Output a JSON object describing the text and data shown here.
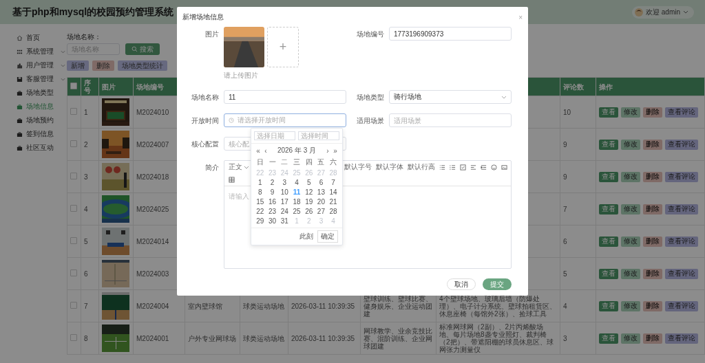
{
  "header": {
    "title": "基于php和mysql的校园预约管理系统",
    "user": "欢迎 admin"
  },
  "sidebar": {
    "items": [
      {
        "label": "首页",
        "selected": false,
        "submenu": false
      },
      {
        "label": "系统管理",
        "selected": false,
        "submenu": true
      },
      {
        "label": "用户管理",
        "selected": false,
        "submenu": true
      },
      {
        "label": "客服管理",
        "selected": false,
        "submenu": true
      },
      {
        "label": "场地类型",
        "selected": false,
        "submenu": false
      },
      {
        "label": "场地信息",
        "selected": true,
        "submenu": false
      },
      {
        "label": "场地预约",
        "selected": false,
        "submenu": false
      },
      {
        "label": "签到信息",
        "selected": false,
        "submenu": false
      },
      {
        "label": "社区互动",
        "selected": false,
        "submenu": false
      }
    ]
  },
  "search": {
    "label": "场地名称：",
    "placeholder": "场地名称",
    "button": "搜索"
  },
  "toolbar": [
    {
      "label": "新增",
      "kind": "add"
    },
    {
      "label": "删除",
      "kind": "delete"
    },
    {
      "label": "场地类型统计",
      "kind": "stats"
    }
  ],
  "table": {
    "header_checked": false,
    "columns": [
      "序号",
      "图片",
      "场地编号",
      "评论数",
      "操作"
    ],
    "rows": [
      {
        "checked": false,
        "index": "1",
        "code": "M2024010",
        "comments": "10",
        "actions": [
          {
            "label": "查看",
            "kind": "view"
          },
          {
            "label": "修改",
            "kind": "edit"
          },
          {
            "label": "删除",
            "kind": "delete"
          },
          {
            "label": "查看评论",
            "kind": "comments"
          }
        ]
      },
      {
        "checked": false,
        "index": "2",
        "code": "M2024007",
        "comments": "9",
        "actions": [
          {
            "label": "查看",
            "kind": "view"
          },
          {
            "label": "修改",
            "kind": "edit"
          },
          {
            "label": "删除",
            "kind": "delete"
          },
          {
            "label": "查看评论",
            "kind": "comments"
          }
        ]
      },
      {
        "checked": false,
        "index": "3",
        "code": "M2024018",
        "comments": "9",
        "actions": [
          {
            "label": "查看",
            "kind": "view"
          },
          {
            "label": "修改",
            "kind": "edit"
          },
          {
            "label": "删除",
            "kind": "delete"
          },
          {
            "label": "查看评论",
            "kind": "comments"
          }
        ]
      },
      {
        "checked": false,
        "index": "4",
        "code": "M2024025",
        "comments": "7",
        "actions": [
          {
            "label": "查看",
            "kind": "view"
          },
          {
            "label": "修改",
            "kind": "edit"
          },
          {
            "label": "删除",
            "kind": "delete"
          },
          {
            "label": "查看评论",
            "kind": "comments"
          }
        ]
      },
      {
        "checked": false,
        "index": "5",
        "code": "M2024014",
        "comments": "6",
        "actions": [
          {
            "label": "查看",
            "kind": "view"
          },
          {
            "label": "修改",
            "kind": "edit"
          },
          {
            "label": "删除",
            "kind": "delete"
          },
          {
            "label": "查看评论",
            "kind": "comments"
          }
        ]
      },
      {
        "checked": false,
        "index": "6",
        "code": "M2024003",
        "comments": "5",
        "actions": [
          {
            "label": "查看",
            "kind": "view"
          },
          {
            "label": "修改",
            "kind": "edit"
          },
          {
            "label": "删除",
            "kind": "delete"
          },
          {
            "label": "查看评论",
            "kind": "comments"
          }
        ]
      },
      {
        "checked": false,
        "index": "7",
        "code": "M2024004",
        "name": "室内壁球馆",
        "type": "球类运动场地",
        "time": "2026-03-11 10:39:35",
        "scene": "壁球训练、壁球比赛、健身娱乐、企业运动团建",
        "config": "4个壁球场地、玻璃后墙（防爆处理）、电子计分系统、壁球拍租赁区、休息座椅（每馆外2张）、捡球工具",
        "comments": "4",
        "actions": [
          {
            "label": "查看",
            "kind": "view"
          },
          {
            "label": "修改",
            "kind": "edit"
          },
          {
            "label": "删除",
            "kind": "delete"
          },
          {
            "label": "查看评论",
            "kind": "comments"
          }
        ]
      },
      {
        "checked": false,
        "index": "8",
        "code": "M2024001",
        "name": "户外专业网球场",
        "type": "球类运动场地",
        "time": "2026-03-11 10:39:35",
        "scene": "网球教学、业余竞技比赛、混阶训练、企业网球团建",
        "config": "标准网球网（2副）、2片丙烯酸场地、每片场地8盏专业照灯、裁判椅（2把）、带遮阳棚的球员休息区、球网张力测量仪",
        "comments": "3",
        "actions": [
          {
            "label": "查看",
            "kind": "view"
          },
          {
            "label": "修改",
            "kind": "edit"
          },
          {
            "label": "删除",
            "kind": "delete"
          },
          {
            "label": "查看评论",
            "kind": "comments"
          }
        ]
      }
    ]
  },
  "dialog": {
    "title": "新增场地信息",
    "close": "×",
    "image": {
      "label": "图片",
      "upload": "+",
      "hint": "请上传图片"
    },
    "code": {
      "label": "场地编号",
      "value": "1773196909373"
    },
    "name": {
      "label": "场地名称",
      "value": "11"
    },
    "type": {
      "label": "场地类型",
      "value": "骑行场地"
    },
    "open_time": {
      "label": "开放时间",
      "placeholder": "请选择开放时间",
      "focused": true
    },
    "scene": {
      "label": "适用场景",
      "placeholder": "适用场景"
    },
    "config": {
      "label": "核心配置",
      "placeholder": "核心配"
    },
    "intro": {
      "label": "简介",
      "format": "正文",
      "toolbar": [
        "默认字号",
        "默认字体",
        "默认行高"
      ],
      "placeholder": "请输入"
    },
    "buttons": [
      {
        "label": "取消",
        "kind": "cancel"
      },
      {
        "label": "提交",
        "kind": "submit"
      }
    ]
  },
  "date_picker": {
    "date_placeholder": "选择日期",
    "time_placeholder": "选择时间",
    "prev_year": "«",
    "prev_month": "‹",
    "title": "2026 年 3 月",
    "next_month": "›",
    "next_year": "»",
    "weekdays": [
      "日",
      "一",
      "二",
      "三",
      "四",
      "五",
      "六"
    ],
    "days": [
      {
        "d": "22",
        "muted": true,
        "today": false
      },
      {
        "d": "23",
        "muted": true,
        "today": false
      },
      {
        "d": "24",
        "muted": true,
        "today": false
      },
      {
        "d": "25",
        "muted": true,
        "today": false
      },
      {
        "d": "26",
        "muted": true,
        "today": false
      },
      {
        "d": "27",
        "muted": true,
        "today": false
      },
      {
        "d": "28",
        "muted": true,
        "today": false
      },
      {
        "d": "1",
        "muted": false,
        "today": false
      },
      {
        "d": "2",
        "muted": false,
        "today": false
      },
      {
        "d": "3",
        "muted": false,
        "today": false
      },
      {
        "d": "4",
        "muted": false,
        "today": false
      },
      {
        "d": "5",
        "muted": false,
        "today": false
      },
      {
        "d": "6",
        "muted": false,
        "today": false
      },
      {
        "d": "7",
        "muted": false,
        "today": false
      },
      {
        "d": "8",
        "muted": false,
        "today": false
      },
      {
        "d": "9",
        "muted": false,
        "today": false
      },
      {
        "d": "10",
        "muted": false,
        "today": false
      },
      {
        "d": "11",
        "muted": false,
        "today": true
      },
      {
        "d": "12",
        "muted": false,
        "today": false
      },
      {
        "d": "13",
        "muted": false,
        "today": false
      },
      {
        "d": "14",
        "muted": false,
        "today": false
      },
      {
        "d": "15",
        "muted": false,
        "today": false
      },
      {
        "d": "16",
        "muted": false,
        "today": false
      },
      {
        "d": "17",
        "muted": false,
        "today": false
      },
      {
        "d": "18",
        "muted": false,
        "today": false
      },
      {
        "d": "19",
        "muted": false,
        "today": false
      },
      {
        "d": "20",
        "muted": false,
        "today": false
      },
      {
        "d": "21",
        "muted": false,
        "today": false
      },
      {
        "d": "22",
        "muted": false,
        "today": false
      },
      {
        "d": "23",
        "muted": false,
        "today": false
      },
      {
        "d": "24",
        "muted": false,
        "today": false
      },
      {
        "d": "25",
        "muted": false,
        "today": false
      },
      {
        "d": "26",
        "muted": false,
        "today": false
      },
      {
        "d": "27",
        "muted": false,
        "today": false
      },
      {
        "d": "28",
        "muted": false,
        "today": false
      },
      {
        "d": "29",
        "muted": false,
        "today": false
      },
      {
        "d": "30",
        "muted": false,
        "today": false
      },
      {
        "d": "31",
        "muted": false,
        "today": false
      },
      {
        "d": "1",
        "muted": true,
        "today": false
      },
      {
        "d": "2",
        "muted": true,
        "today": false
      },
      {
        "d": "3",
        "muted": true,
        "today": false
      },
      {
        "d": "4",
        "muted": true,
        "today": false
      }
    ],
    "now": "此刻",
    "ok": "确定"
  }
}
